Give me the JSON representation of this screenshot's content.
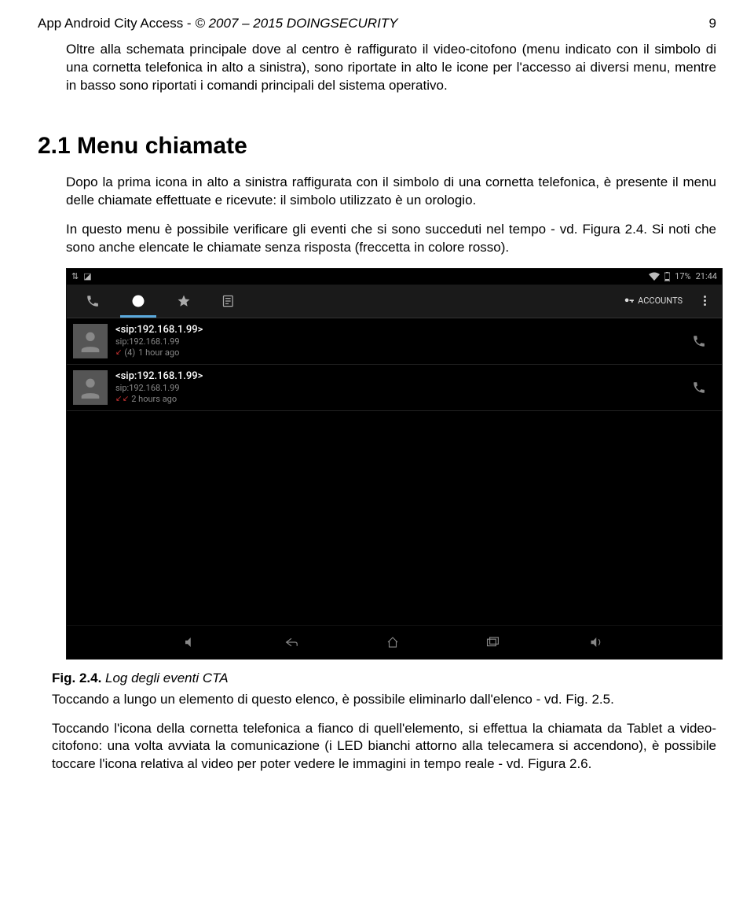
{
  "header": {
    "title_prefix": "App Android City Access - ",
    "copyright": "© 2007 – 2015 DOINGSECURITY",
    "page_number": "9"
  },
  "para1": "Oltre alla schemata principale dove al centro è raffigurato il video-citofono (menu indicato con il simbolo di una cornetta telefonica in alto a sinistra), sono riportate in alto le icone per l'accesso ai diversi menu, mentre in basso sono riportati i comandi principali del sistema operativo.",
  "section_heading": "2.1 Menu chiamate",
  "para2": "Dopo la prima icona in alto a sinistra raffigurata con il simbolo di una cornetta telefonica, è presente il menu delle chiamate effettuate e ricevute: il simbolo utilizzato è un orologio.",
  "para3": "In questo menu è possibile verificare gli eventi che si sono succeduti nel tempo - vd. Figura 2.4. Si noti che sono anche elencate le chiamate senza risposta (freccetta in colore rosso).",
  "screenshot": {
    "status": {
      "left_icons": "⇅  ⛉",
      "wifi": "wifi",
      "battery_text": "17%",
      "time": "21:44"
    },
    "tabs": {
      "accounts_label": "ACCOUNTS"
    },
    "calls": [
      {
        "title": "<sip:192.168.1.99>",
        "sub": "sip:192.168.1.99",
        "meta_count": "(4)",
        "meta_time": "1 hour ago",
        "arrows": "↙"
      },
      {
        "title": "<sip:192.168.1.99>",
        "sub": "sip:192.168.1.99",
        "meta_count": "",
        "meta_time": "2 hours ago",
        "arrows": "↙ ↙"
      }
    ]
  },
  "caption": {
    "bold": "Fig. 2.4.",
    "italic": " Log degli eventi CTA"
  },
  "para4": "Toccando a lungo un elemento di questo elenco, è possibile eliminarlo dall'elenco - vd. Fig. 2.5.",
  "para5": "Toccando l'icona della cornetta telefonica a fianco di quell'elemento, si effettua la chiamata da Tablet a video-citofono: una volta avviata la comunicazione (i LED bianchi attorno alla telecamera si accendono), è possibile toccare l'icona relativa al video per poter vedere le immagini in tempo reale - vd. Figura 2.6."
}
